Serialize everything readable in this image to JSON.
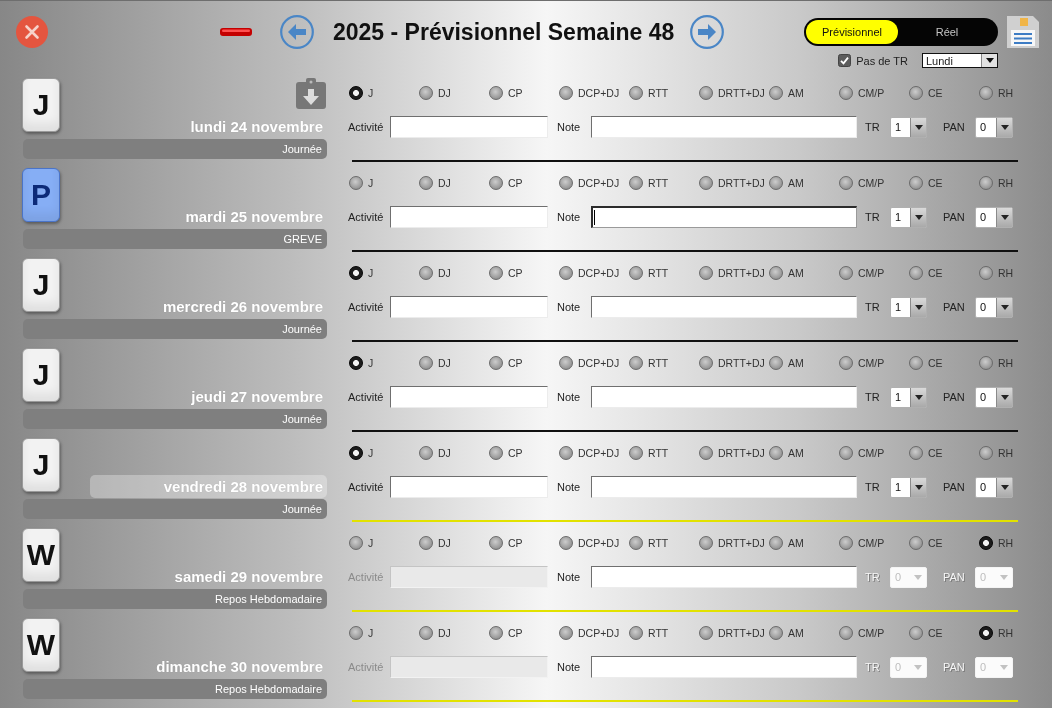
{
  "header": {
    "title": "2025 - Prévisionnel Semaine 48",
    "mode_toggle": [
      {
        "label": "Prévisionnel",
        "selected": true
      },
      {
        "label": "Réel",
        "selected": false
      }
    ],
    "no_tr_checkbox": {
      "label": "Pas de TR",
      "checked": true
    },
    "start_day_dropdown": {
      "value": "Lundi"
    }
  },
  "days": [
    {
      "badge": {
        "letter": "J",
        "color": "#f2f2f2"
      },
      "date": "lundi 24 novembre",
      "selected": false,
      "clipboard_icon": true,
      "label": "Journée",
      "options": [
        {
          "label": "J",
          "selected": true
        },
        {
          "label": "DJ",
          "selected": false
        },
        {
          "label": "CP",
          "selected": false
        },
        {
          "label": "DCP+DJ",
          "selected": false
        },
        {
          "label": "RTT",
          "selected": false
        },
        {
          "label": "DRTT+DJ",
          "selected": false
        },
        {
          "label": "AM",
          "selected": false
        },
        {
          "label": "CM/P",
          "selected": false
        },
        {
          "label": "CE",
          "selected": false
        },
        {
          "label": "RH",
          "selected": false
        }
      ],
      "activity": {
        "label": "Activité",
        "disabled": false
      },
      "note": {
        "label": "Note",
        "focused": false
      },
      "tr": {
        "label": "TR",
        "value": "1",
        "disabled": false
      },
      "pan": {
        "label": "PAN",
        "value": "0",
        "disabled": false
      },
      "separator": {
        "color": "#111111"
      }
    },
    {
      "badge": {
        "letter": "P",
        "color": "#86aef5"
      },
      "date": "mardi 25 novembre",
      "selected": false,
      "label": "GREVE",
      "options": [
        {
          "label": "J",
          "selected": false
        },
        {
          "label": "DJ",
          "selected": false
        },
        {
          "label": "CP",
          "selected": false
        },
        {
          "label": "DCP+DJ",
          "selected": false
        },
        {
          "label": "RTT",
          "selected": false
        },
        {
          "label": "DRTT+DJ",
          "selected": false
        },
        {
          "label": "AM",
          "selected": false
        },
        {
          "label": "CM/P",
          "selected": false
        },
        {
          "label": "CE",
          "selected": false
        },
        {
          "label": "RH",
          "selected": false
        }
      ],
      "activity": {
        "label": "Activité",
        "disabled": false
      },
      "note": {
        "label": "Note",
        "focused": true
      },
      "tr": {
        "label": "TR",
        "value": "1",
        "disabled": false
      },
      "pan": {
        "label": "PAN",
        "value": "0",
        "disabled": false
      },
      "separator": {
        "color": "#111111"
      }
    },
    {
      "badge": {
        "letter": "J",
        "color": "#f2f2f2"
      },
      "date": "mercredi 26 novembre",
      "selected": false,
      "label": "Journée",
      "options": [
        {
          "label": "J",
          "selected": true
        },
        {
          "label": "DJ",
          "selected": false
        },
        {
          "label": "CP",
          "selected": false
        },
        {
          "label": "DCP+DJ",
          "selected": false
        },
        {
          "label": "RTT",
          "selected": false
        },
        {
          "label": "DRTT+DJ",
          "selected": false
        },
        {
          "label": "AM",
          "selected": false
        },
        {
          "label": "CM/P",
          "selected": false
        },
        {
          "label": "CE",
          "selected": false
        },
        {
          "label": "RH",
          "selected": false
        }
      ],
      "activity": {
        "label": "Activité",
        "disabled": false
      },
      "note": {
        "label": "Note",
        "focused": false
      },
      "tr": {
        "label": "TR",
        "value": "1",
        "disabled": false
      },
      "pan": {
        "label": "PAN",
        "value": "0",
        "disabled": false
      },
      "separator": {
        "color": "#111111"
      }
    },
    {
      "badge": {
        "letter": "J",
        "color": "#f2f2f2"
      },
      "date": "jeudi 27 novembre",
      "selected": false,
      "label": "Journée",
      "options": [
        {
          "label": "J",
          "selected": true
        },
        {
          "label": "DJ",
          "selected": false
        },
        {
          "label": "CP",
          "selected": false
        },
        {
          "label": "DCP+DJ",
          "selected": false
        },
        {
          "label": "RTT",
          "selected": false
        },
        {
          "label": "DRTT+DJ",
          "selected": false
        },
        {
          "label": "AM",
          "selected": false
        },
        {
          "label": "CM/P",
          "selected": false
        },
        {
          "label": "CE",
          "selected": false
        },
        {
          "label": "RH",
          "selected": false
        }
      ],
      "activity": {
        "label": "Activité",
        "disabled": false
      },
      "note": {
        "label": "Note",
        "focused": false
      },
      "tr": {
        "label": "TR",
        "value": "1",
        "disabled": false
      },
      "pan": {
        "label": "PAN",
        "value": "0",
        "disabled": false
      },
      "separator": {
        "color": "#111111"
      }
    },
    {
      "badge": {
        "letter": "J",
        "color": "#f2f2f2"
      },
      "date": "vendredi 28 novembre",
      "selected": true,
      "label": "Journée",
      "options": [
        {
          "label": "J",
          "selected": true
        },
        {
          "label": "DJ",
          "selected": false
        },
        {
          "label": "CP",
          "selected": false
        },
        {
          "label": "DCP+DJ",
          "selected": false
        },
        {
          "label": "RTT",
          "selected": false
        },
        {
          "label": "DRTT+DJ",
          "selected": false
        },
        {
          "label": "AM",
          "selected": false
        },
        {
          "label": "CM/P",
          "selected": false
        },
        {
          "label": "CE",
          "selected": false
        },
        {
          "label": "RH",
          "selected": false
        }
      ],
      "activity": {
        "label": "Activité",
        "disabled": false
      },
      "note": {
        "label": "Note",
        "focused": false
      },
      "tr": {
        "label": "TR",
        "value": "1",
        "disabled": false
      },
      "pan": {
        "label": "PAN",
        "value": "0",
        "disabled": false
      },
      "separator": {
        "color": "#e2e200"
      }
    },
    {
      "badge": {
        "letter": "W",
        "color": "#f2f2f2"
      },
      "date": "samedi 29 novembre",
      "selected": false,
      "label": "Repos Hebdomadaire",
      "options": [
        {
          "label": "J",
          "selected": false
        },
        {
          "label": "DJ",
          "selected": false
        },
        {
          "label": "CP",
          "selected": false
        },
        {
          "label": "DCP+DJ",
          "selected": false
        },
        {
          "label": "RTT",
          "selected": false
        },
        {
          "label": "DRTT+DJ",
          "selected": false
        },
        {
          "label": "AM",
          "selected": false
        },
        {
          "label": "CM/P",
          "selected": false
        },
        {
          "label": "CE",
          "selected": false
        },
        {
          "label": "RH",
          "selected": true
        }
      ],
      "activity": {
        "label": "Activité",
        "disabled": true
      },
      "note": {
        "label": "Note",
        "focused": false
      },
      "tr": {
        "label": "TR",
        "value": "0",
        "disabled": true
      },
      "pan": {
        "label": "PAN",
        "value": "0",
        "disabled": true
      },
      "separator": {
        "color": "#e2e200"
      }
    },
    {
      "badge": {
        "letter": "W",
        "color": "#f2f2f2"
      },
      "date": "dimanche 30 novembre",
      "selected": false,
      "label": "Repos Hebdomadaire",
      "options": [
        {
          "label": "J",
          "selected": false
        },
        {
          "label": "DJ",
          "selected": false
        },
        {
          "label": "CP",
          "selected": false
        },
        {
          "label": "DCP+DJ",
          "selected": false
        },
        {
          "label": "RTT",
          "selected": false
        },
        {
          "label": "DRTT+DJ",
          "selected": false
        },
        {
          "label": "AM",
          "selected": false
        },
        {
          "label": "CM/P",
          "selected": false
        },
        {
          "label": "CE",
          "selected": false
        },
        {
          "label": "RH",
          "selected": true
        }
      ],
      "activity": {
        "label": "Activité",
        "disabled": true
      },
      "note": {
        "label": "Note",
        "focused": false
      },
      "tr": {
        "label": "TR",
        "value": "0",
        "disabled": true
      },
      "pan": {
        "label": "PAN",
        "value": "0",
        "disabled": true
      },
      "separator": {
        "color": "#e2e200"
      }
    }
  ]
}
